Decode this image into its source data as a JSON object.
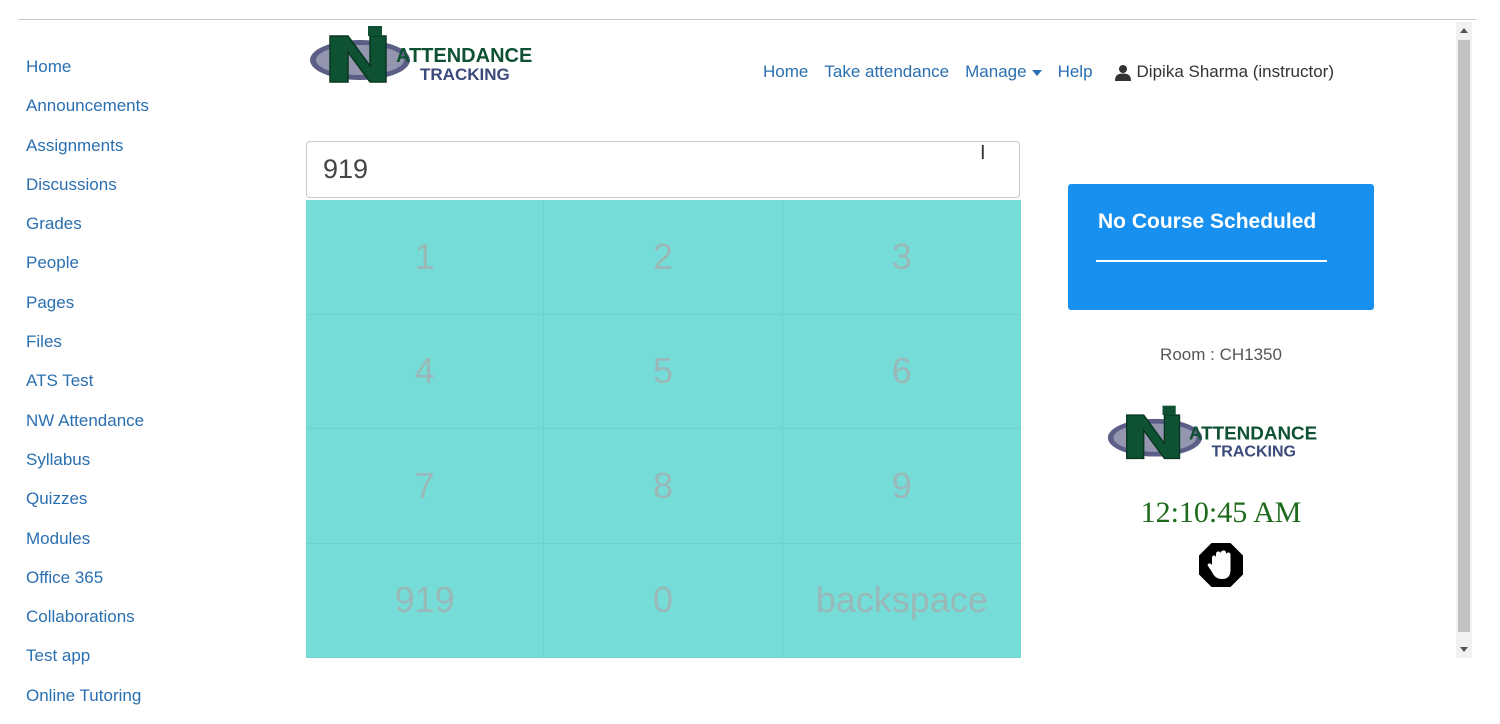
{
  "sidebar": {
    "items": [
      {
        "label": "Home"
      },
      {
        "label": "Announcements"
      },
      {
        "label": "Assignments"
      },
      {
        "label": "Discussions"
      },
      {
        "label": "Grades"
      },
      {
        "label": "People"
      },
      {
        "label": "Pages"
      },
      {
        "label": "Files"
      },
      {
        "label": "ATS Test"
      },
      {
        "label": "NW Attendance"
      },
      {
        "label": "Syllabus"
      },
      {
        "label": "Quizzes"
      },
      {
        "label": "Modules"
      },
      {
        "label": "Office 365"
      },
      {
        "label": "Collaborations"
      },
      {
        "label": "Test app"
      },
      {
        "label": "Online Tutoring"
      }
    ]
  },
  "logo": {
    "line1": "ATTENDANCE",
    "line2": "TRACKING"
  },
  "topnav": {
    "home": "Home",
    "take_attendance": "Take attendance",
    "manage": "Manage",
    "help": "Help",
    "user": "Dipika Sharma (instructor)"
  },
  "pin": {
    "value": "919"
  },
  "keypad": {
    "keys": [
      "1",
      "2",
      "3",
      "4",
      "5",
      "6",
      "7",
      "8",
      "9",
      "919",
      "0",
      "backspace"
    ]
  },
  "course": {
    "title": "No Course Scheduled"
  },
  "room": "Room : CH1350",
  "clock": "12:10:45 AM",
  "colors": {
    "link": "#2a6fb0",
    "keypad": "#76dcd8",
    "card": "#1890f0",
    "clock": "#1d6a1d"
  }
}
